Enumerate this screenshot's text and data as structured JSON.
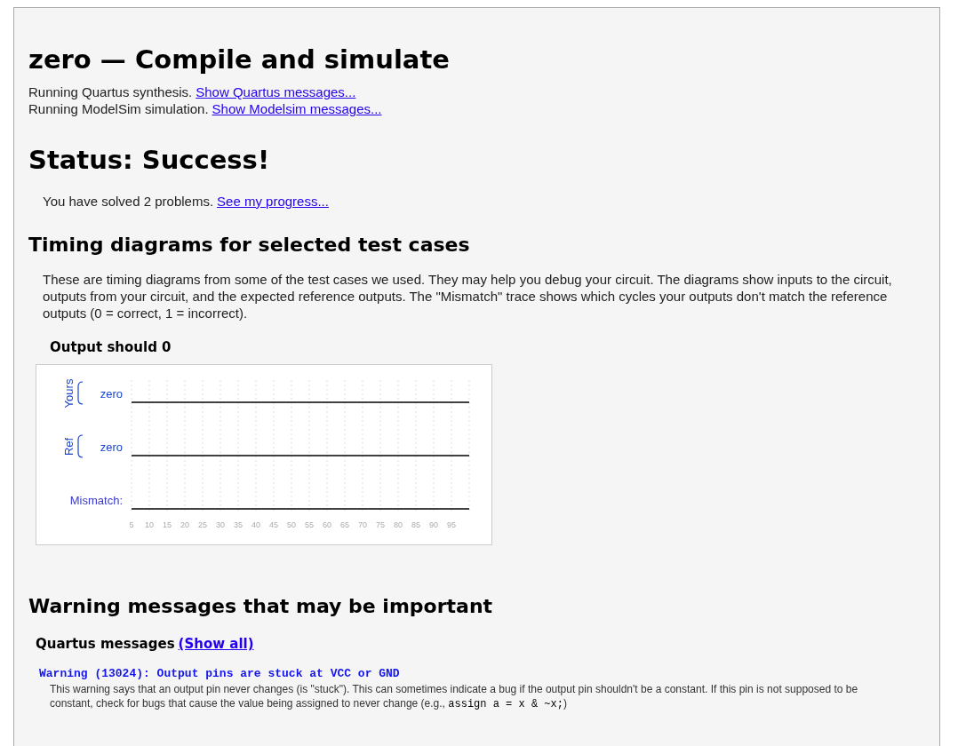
{
  "title": "zero — Compile and simulate",
  "run_lines": [
    {
      "text": "Running Quartus synthesis.",
      "link": "Show Quartus messages..."
    },
    {
      "text": "Running ModelSim simulation.",
      "link": "Show Modelsim messages..."
    }
  ],
  "status": {
    "heading": "Status: Success!",
    "text": "You have solved 2 problems.",
    "link": "See my progress..."
  },
  "timing": {
    "heading": "Timing diagrams for selected test cases",
    "description": "These are timing diagrams from some of the test cases we used. They may help you debug your circuit. The diagrams show inputs to the circuit, outputs from your circuit, and the expected reference outputs. The \"Mismatch\" trace shows which cycles your outputs don't match the reference outputs (0 = correct, 1 = incorrect).",
    "case_title": "Output should 0",
    "groups": [
      {
        "label": "Yours",
        "signal": "zero"
      },
      {
        "label": "Ref",
        "signal": "zero"
      }
    ],
    "mismatch_label": "Mismatch:",
    "ticks": [
      "5",
      "10",
      "15",
      "20",
      "25",
      "30",
      "35",
      "40",
      "45",
      "50",
      "55",
      "60",
      "65",
      "70",
      "75",
      "80",
      "85",
      "90",
      "95"
    ]
  },
  "warnings": {
    "heading": "Warning messages that may be important",
    "source": "Quartus messages",
    "show_all": "(Show all)",
    "items": [
      {
        "title": "Warning (13024): Output pins are stuck at VCC or GND",
        "text": "This warning says that an output pin never changes (is \"stuck\"). This can sometimes indicate a bug if the output pin shouldn't be a constant. If this pin is not supposed to be constant, check for bugs that cause the value being assigned to never change (e.g.,",
        "code": "assign a = x & ~x;",
        "text_end": ")"
      }
    ]
  }
}
